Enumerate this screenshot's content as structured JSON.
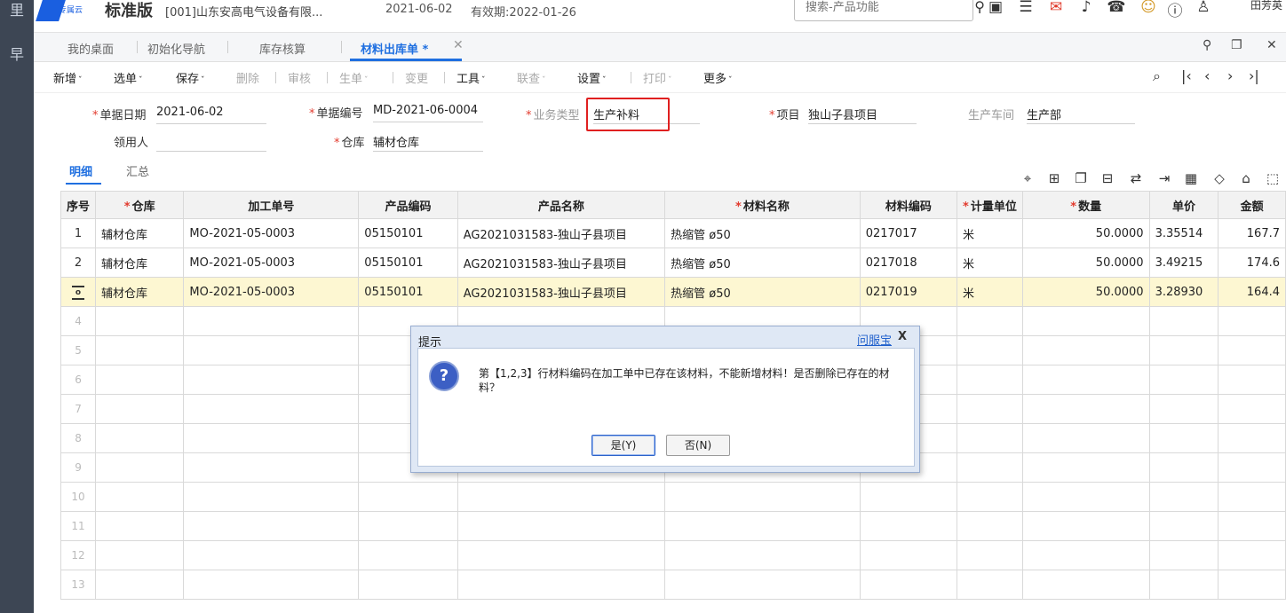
{
  "left_rail": {
    "glyph_top": "里",
    "glyph_mid": "早"
  },
  "header": {
    "logo_sub": "专属云",
    "edition": "标准版",
    "company": "[001]山东安高电气设备有限...",
    "date": "2021-06-02",
    "validity": "有效期:2022-01-26",
    "search_placeholder": "搜索-产品功能",
    "user": "田芳英"
  },
  "tabs": [
    {
      "label": "我的桌面"
    },
    {
      "label": "初始化导航"
    },
    {
      "label": "库存核算"
    },
    {
      "label": "材料出库单 *"
    }
  ],
  "toolbar": {
    "add": "新增",
    "select": "选单",
    "save": "保存",
    "delete": "删除",
    "audit": "审核",
    "generate": "生单",
    "change": "变更",
    "tools": "工具",
    "linkquery": "联查",
    "settings": "设置",
    "print": "打印",
    "more": "更多"
  },
  "form": {
    "doc_date_label": "单据日期",
    "doc_date": "2021-06-02",
    "doc_no_label": "单据编号",
    "doc_no": "MD-2021-06-0004",
    "biz_type_label": "业务类型",
    "biz_type": "生产补料",
    "project_label": "项目",
    "project": "独山子县项目",
    "workshop_label": "生产车间",
    "workshop": "生产部",
    "receiver_label": "领用人",
    "receiver": "",
    "warehouse_label": "仓库",
    "warehouse": "辅材仓库"
  },
  "subtabs": {
    "detail": "明细",
    "summary": "汇总"
  },
  "grid": {
    "headers": [
      "序号",
      "仓库",
      "加工单号",
      "产品编码",
      "产品名称",
      "材料名称",
      "材料编码",
      "计量单位",
      "数量",
      "单价",
      "金额"
    ],
    "rows": [
      {
        "idx": "1",
        "warehouse": "辅材仓库",
        "mo": "MO-2021-05-0003",
        "prod_code": "05150101",
        "prod_name": "AG2021031583-独山子县项目",
        "mat_name": "热缩管 ø50",
        "mat_code": "0217017",
        "unit": "米",
        "qty": "50.0000",
        "price": "3.35514",
        "amount": "167.7"
      },
      {
        "idx": "2",
        "warehouse": "辅材仓库",
        "mo": "MO-2021-05-0003",
        "prod_code": "05150101",
        "prod_name": "AG2021031583-独山子县项目",
        "mat_name": "热缩管 ø50",
        "mat_code": "0217018",
        "unit": "米",
        "qty": "50.0000",
        "price": "3.49215",
        "amount": "174.6"
      },
      {
        "idx": "",
        "warehouse": "辅材仓库",
        "mo": "MO-2021-05-0003",
        "prod_code": "05150101",
        "prod_name": "AG2021031583-独山子县项目",
        "mat_name": "热缩管 ø50",
        "mat_code": "0217019",
        "unit": "米",
        "qty": "50.0000",
        "price": "3.28930",
        "amount": "164.4"
      }
    ],
    "empty_rows": [
      "4",
      "5",
      "6",
      "7",
      "8",
      "9",
      "10",
      "11",
      "12",
      "13"
    ]
  },
  "dialog": {
    "title": "提示",
    "help": "问服宝",
    "close": "X",
    "message": "第【1,2,3】行材料编码在加工单中已存在该材料，不能新增材料！是否删除已存在的材料？",
    "yes": "是(Y)",
    "no": "否(N)"
  }
}
